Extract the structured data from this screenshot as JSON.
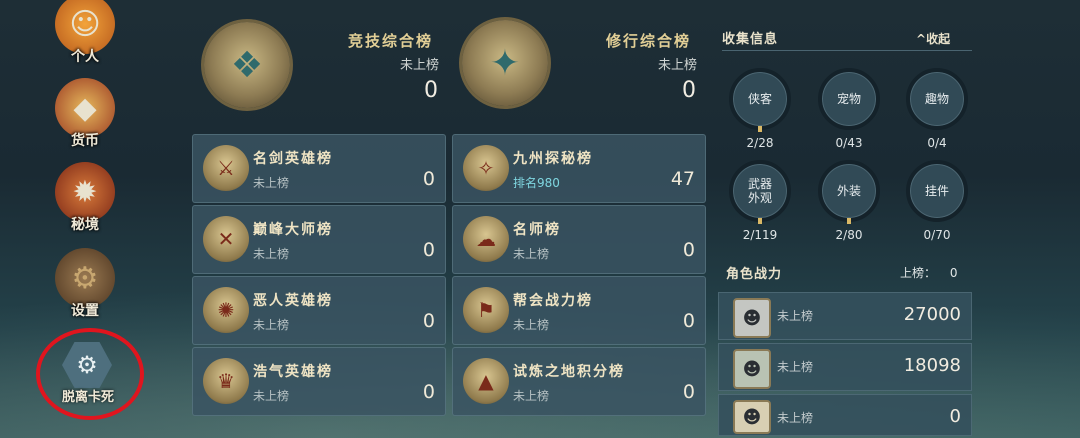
{
  "menu": {
    "personal": "个人",
    "currency": "货币",
    "secret_realm": "秘境",
    "settings": "设置",
    "unstick": "脱离卡死"
  },
  "top": {
    "arena": {
      "title": "竞技综合榜",
      "status": "未上榜",
      "value": "0"
    },
    "cultivation": {
      "title": "修行综合榜",
      "status": "未上榜",
      "value": "0"
    }
  },
  "boards": [
    {
      "title": "名剑英雄榜",
      "status": "未上榜",
      "value": "0"
    },
    {
      "title": "九州探秘榜",
      "status": "排名980",
      "value": "47"
    },
    {
      "title": "巅峰大师榜",
      "status": "未上榜",
      "value": "0"
    },
    {
      "title": "名师榜",
      "status": "未上榜",
      "value": "0"
    },
    {
      "title": "恶人英雄榜",
      "status": "未上榜",
      "value": "0"
    },
    {
      "title": "帮会战力榜",
      "status": "未上榜",
      "value": "0"
    },
    {
      "title": "浩气英雄榜",
      "status": "未上榜",
      "value": "0"
    },
    {
      "title": "试炼之地积分榜",
      "status": "未上榜",
      "value": "0"
    }
  ],
  "collection": {
    "title": "收集信息",
    "collapse": "收起",
    "items": [
      {
        "label": "侠客",
        "count": "2/28"
      },
      {
        "label": "宠物",
        "count": "0/43"
      },
      {
        "label": "趣物",
        "count": "0/4"
      },
      {
        "label": "武器外观",
        "count": "2/119"
      },
      {
        "label": "外装",
        "count": "2/80"
      },
      {
        "label": "挂件",
        "count": "0/70"
      }
    ]
  },
  "power": {
    "title": "角色战力",
    "rank_label": "上榜：",
    "rank_value": "0",
    "rows": [
      {
        "status": "未上榜",
        "value": "27000"
      },
      {
        "status": "未上榜",
        "value": "18098"
      },
      {
        "status": "未上榜",
        "value": "0"
      }
    ]
  },
  "colors": {
    "highlight_ring": "#e0151e",
    "panel": "#3a5461",
    "gold_text": "#e2cf96"
  }
}
